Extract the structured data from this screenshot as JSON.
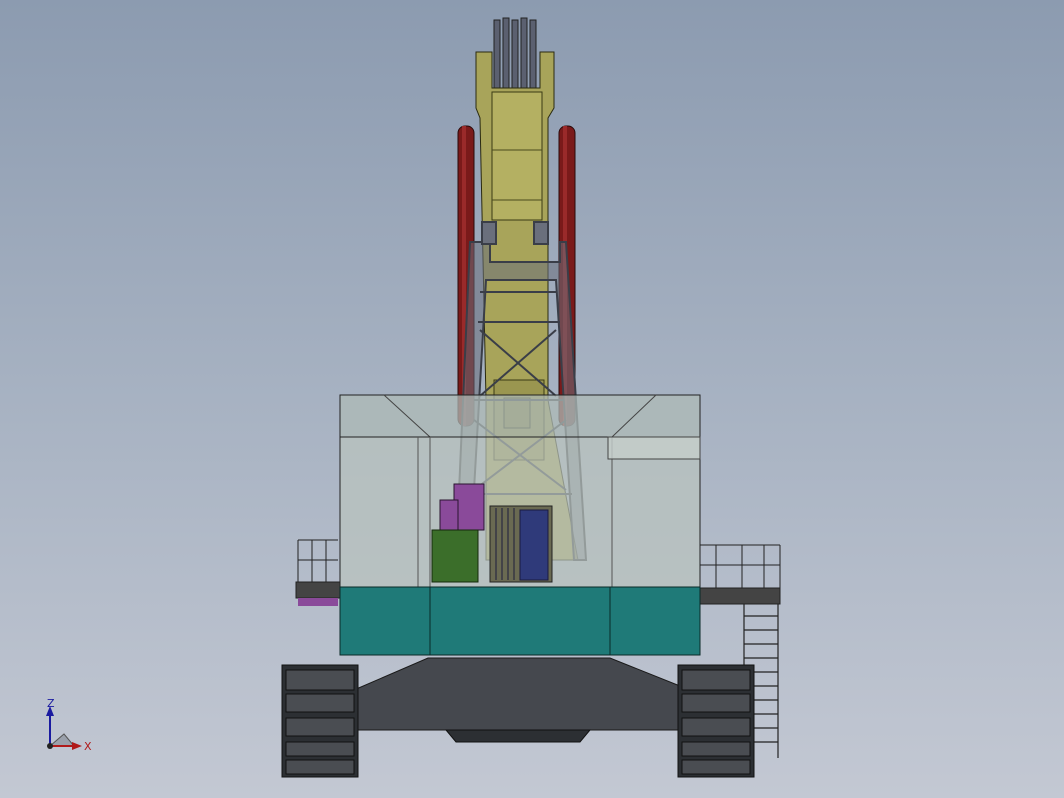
{
  "viewport": {
    "model": "crawler-excavator-front-view"
  },
  "colors": {
    "background_top": "#8c9bb0",
    "background_bottom": "#c3c8d3",
    "boom": "#a8a45a",
    "cylinder": "#7a1a1a",
    "frame": "#5b6070",
    "cab_glass": "#b9c3be",
    "deck": "#1f7a78",
    "undercarriage": "#45484e",
    "track": "#2c2f33",
    "motor_purple": "#8a4a9a",
    "motor_green": "#3b6e2a"
  },
  "triad": {
    "z_label": "Z",
    "x_label": "X",
    "z_color": "#1a1aa0",
    "x_color": "#b01a1a"
  }
}
